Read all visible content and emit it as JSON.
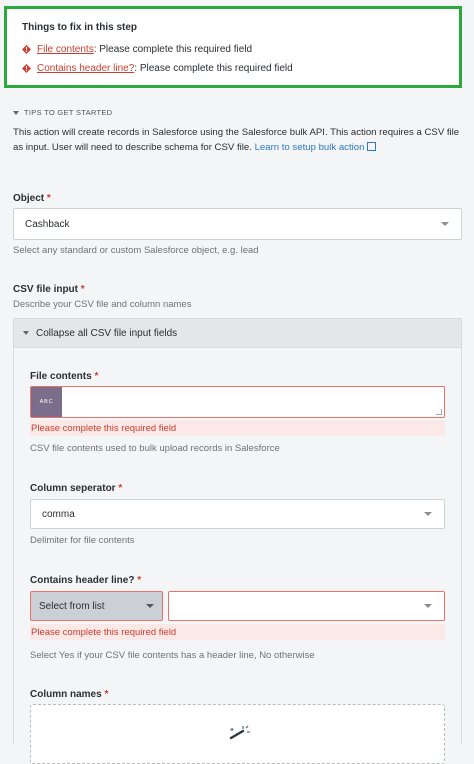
{
  "fixes": {
    "title": "Things to fix in this step",
    "items": [
      {
        "link": "File contents",
        "message": ": Please complete this required field"
      },
      {
        "link": "Contains header line?",
        "message": ": Please complete this required field"
      }
    ]
  },
  "tips": {
    "heading": "TIPS TO GET STARTED",
    "text": "This action will create records in Salesforce using the Salesforce bulk API. This action requires a CSV file as input. User will need to describe schema for CSV file.",
    "link": "Learn to setup bulk action"
  },
  "object_field": {
    "label": "Object",
    "required": "*",
    "value": "Cashback",
    "hint": "Select any standard or custom Salesforce object, e.g. lead"
  },
  "csv_input": {
    "label": "CSV file input",
    "required": "*",
    "hint": "Describe your CSV file and column names",
    "collapse_label": "Collapse all CSV file input fields"
  },
  "file_contents": {
    "label": "File contents",
    "required": "*",
    "badge": "ABC",
    "error": "Please complete this required field",
    "hint": "CSV file contents used to bulk upload records in Salesforce"
  },
  "column_separator": {
    "label": "Column seperator",
    "required": "*",
    "value": "comma",
    "hint": "Delimiter for file contents"
  },
  "header_line": {
    "label": "Contains header line?",
    "required": "*",
    "mode": "Select from list",
    "error": "Please complete this required field",
    "hint": "Select Yes if your CSV file contents has a header line, No otherwise"
  },
  "column_names": {
    "label": "Column names",
    "required": "*"
  },
  "colors": {
    "error": "#d03b2c",
    "link": "#2c78c8",
    "highlight_border": "#2aa93c"
  }
}
